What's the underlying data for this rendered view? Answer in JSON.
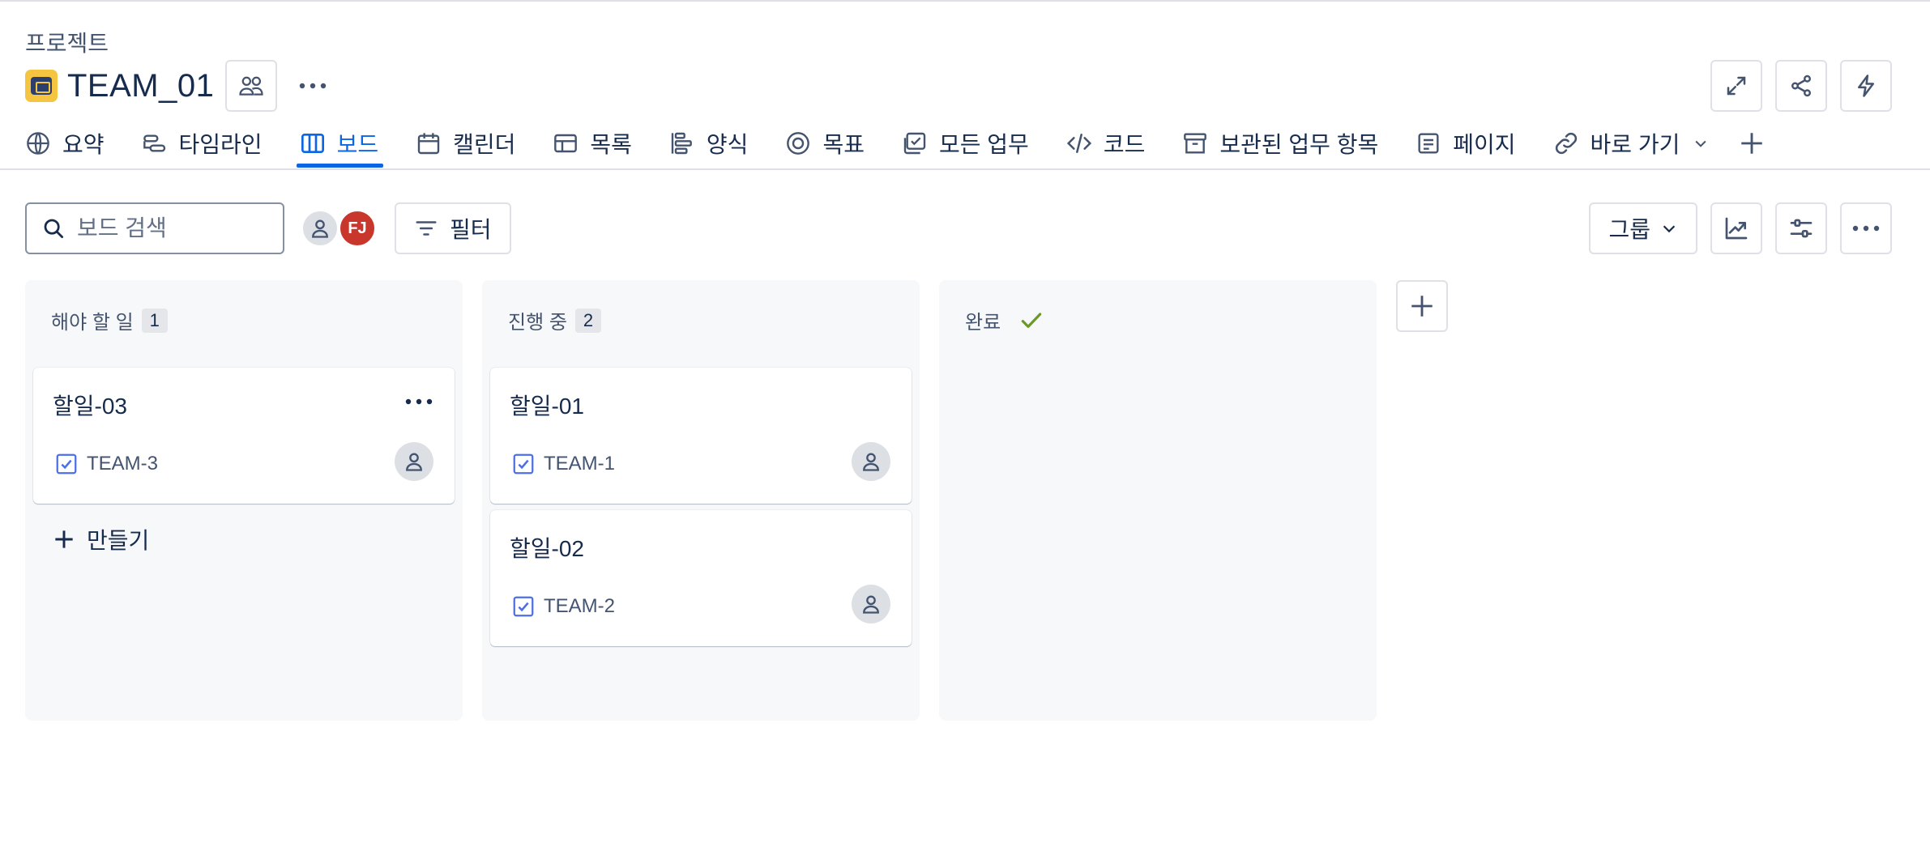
{
  "header": {
    "breadcrumb": "프로젝트",
    "project_name": "TEAM_01"
  },
  "tabs": [
    {
      "label": "요약",
      "icon": "globe-icon"
    },
    {
      "label": "타임라인",
      "icon": "timeline-icon"
    },
    {
      "label": "보드",
      "icon": "board-icon",
      "active": true
    },
    {
      "label": "캘린더",
      "icon": "calendar-icon"
    },
    {
      "label": "목록",
      "icon": "list-icon"
    },
    {
      "label": "양식",
      "icon": "form-icon"
    },
    {
      "label": "목표",
      "icon": "target-icon"
    },
    {
      "label": "모든 업무",
      "icon": "all-work-icon"
    },
    {
      "label": "코드",
      "icon": "code-icon"
    },
    {
      "label": "보관된 업무 항목",
      "icon": "archive-icon"
    },
    {
      "label": "페이지",
      "icon": "page-icon"
    },
    {
      "label": "바로 가기",
      "icon": "link-icon"
    }
  ],
  "toolbar": {
    "search_placeholder": "보드 검색",
    "avatar_initials": "FJ",
    "filter_label": "필터",
    "group_label": "그룹"
  },
  "columns": [
    {
      "title": "해야 할 일",
      "count": "1",
      "cards": [
        {
          "title": "할일-03",
          "key": "TEAM-3"
        }
      ],
      "create_label": "만들기"
    },
    {
      "title": "진행 중",
      "count": "2",
      "cards": [
        {
          "title": "할일-01",
          "key": "TEAM-1"
        },
        {
          "title": "할일-02",
          "key": "TEAM-2"
        }
      ]
    },
    {
      "title": "완료",
      "done": true,
      "cards": []
    }
  ],
  "colors": {
    "accent": "#0c66e4",
    "done_check": "#6a9a23",
    "avatar_fj": "#c9372c",
    "column_bg": "#f7f8f9"
  }
}
